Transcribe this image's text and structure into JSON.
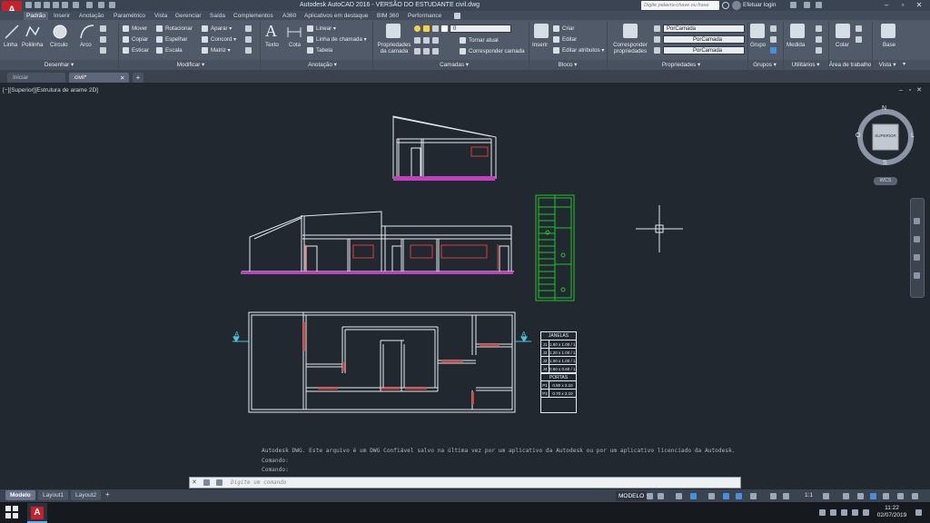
{
  "titlebar": {
    "app_menu_label": "A",
    "title": "Autodesk AutoCAD 2016 - VERSÃO DO ESTUDANTE    civil.dwg",
    "search_placeholder": "Digite palavra-chave ou frase",
    "login_label": "Efetuar login"
  },
  "ribbon_tabs": [
    "Padrão",
    "Inserir",
    "Anotação",
    "Paramétrico",
    "Vista",
    "Gerenciar",
    "Saída",
    "Complementos",
    "A360",
    "Aplicativos em destaque",
    "BIM 360",
    "Performance"
  ],
  "ribbon": {
    "draw": {
      "linha": "Linha",
      "polilinha": "Polilinha",
      "circulo": "Círculo",
      "arco": "Arco",
      "title": "Desenhar ▾"
    },
    "modify": {
      "mover": "Mover",
      "copiar": "Copiar",
      "esticar": "Esticar",
      "rotacionar": "Rotacionar",
      "espelhar": "Espelhar",
      "escala": "Escala",
      "aparar": "Aparar ▾",
      "concord": "Concord ▾",
      "matriz": "Matriz ▾",
      "title": "Modificar ▾"
    },
    "annotation": {
      "texto": "Texto",
      "cota": "Cota",
      "linear": "Linear ▾",
      "linha_chamada": "Linha de chamada ▾",
      "tabela": "Tabela",
      "title": "Anotação ▾"
    },
    "layers": {
      "props": "Propriedades da camada",
      "layer_value": "0",
      "tornar_atual": "Tornar atual",
      "corresponder": "Corresponder camada",
      "title": "Camadas ▾"
    },
    "block": {
      "inserir": "Inserir",
      "criar": "Criar",
      "editar": "Editar",
      "editar_atributos": "Editar atributos ▾",
      "title": "Bloco ▾"
    },
    "properties": {
      "corresponder": "Corresponder propriedades",
      "color": "PorCamada",
      "linetype": "PorCamada",
      "lineweight": "PorCamada",
      "title": "Propriedades ▾"
    },
    "groups": {
      "grupo": "Grupo",
      "title": "Grupos ▾"
    },
    "utilities": {
      "medida": "Medida",
      "title": "Utilitários ▾"
    },
    "clipboard": {
      "colar": "Colar",
      "title": "Área de trabalho"
    },
    "view": {
      "base": "Base",
      "title": "Vista ▾"
    }
  },
  "doc_tabs": {
    "start": "Iniciar",
    "active": "civil*",
    "add": "+"
  },
  "viewport": {
    "label": "[−][Superior][Estrutura de arame 2D]",
    "viewcube": {
      "north": "N",
      "south": "S",
      "east": "L",
      "west": "O",
      "face": "SUPERIOR",
      "wcs": "WCS"
    },
    "section_marks": [
      "A",
      "A"
    ]
  },
  "tables": {
    "janelas": {
      "title": "JANELAS",
      "rows": [
        {
          "id": "J1",
          "text": "1.60 x 1.00 / 1.00"
        },
        {
          "id": "J2",
          "text": "1.20 x 1.00 / 1.00"
        },
        {
          "id": "J3",
          "text": "1.00 x 1.00 / 1.00"
        },
        {
          "id": "J4",
          "text": "0.60 x 0.60 / 1.60"
        }
      ]
    },
    "portas": {
      "title": "PORTAS",
      "rows": [
        {
          "id": "P1",
          "text": "0.80 x 2.10"
        },
        {
          "id": "P2",
          "text": "0.70 x 2.10"
        }
      ]
    }
  },
  "command": {
    "history": [
      "Autodesk DWG. Este arquivo é um DWG Confiável salvo na última vez por um aplicativo da Autodesk ou por um aplicativo licenciado da Autodesk.",
      "Comando:",
      "Comando:"
    ],
    "placeholder": "Digite um comando"
  },
  "layout_tabs": [
    "Modelo",
    "Layout1",
    "Layout2"
  ],
  "status": {
    "model": "MODELO",
    "scale": "1:1"
  },
  "taskbar": {
    "time": "11:22",
    "date": "02/07/2019"
  },
  "colors": {
    "background": "#212830",
    "lines_white": "#e6e9ee",
    "walls_red": "#e03a3a",
    "hatch_magenta": "#c040c0",
    "stair_green": "#22c22a",
    "section_cyan": "#49c6dc"
  }
}
